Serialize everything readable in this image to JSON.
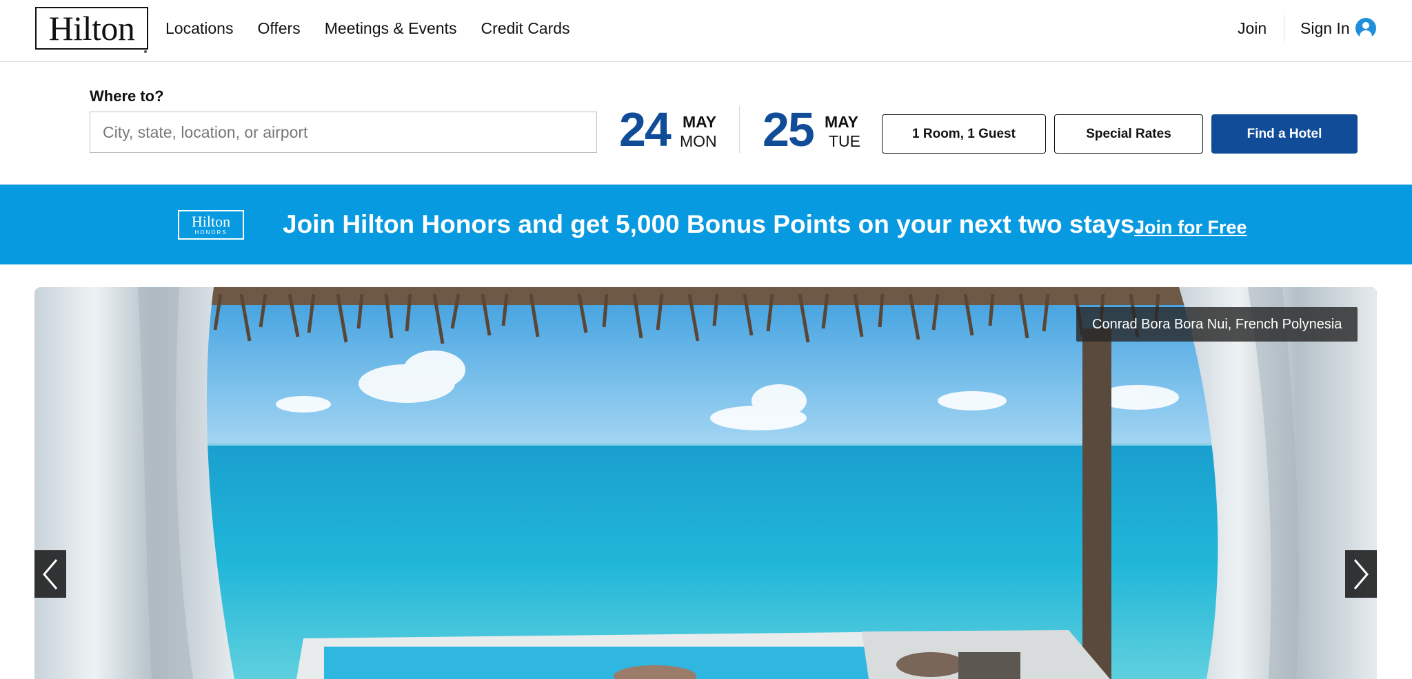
{
  "header": {
    "logo_text": "Hilton",
    "nav": [
      "Locations",
      "Offers",
      "Meetings & Events",
      "Credit Cards"
    ],
    "join": "Join",
    "sign_in": "Sign In",
    "user_icon": "user-circle-icon"
  },
  "search": {
    "where_label": "Where to?",
    "where_placeholder": "City, state, location, or airport",
    "check_in": {
      "day": "24",
      "month": "MAY",
      "weekday": "MON"
    },
    "check_out": {
      "day": "25",
      "month": "MAY",
      "weekday": "TUE"
    },
    "rooms_guests": "1 Room, 1 Guest",
    "special_rates": "Special Rates",
    "find_hotel": "Find a Hotel"
  },
  "banner": {
    "logo_text": "Hilton",
    "logo_subtext": "HONORS",
    "message": "Join Hilton Honors and get 5,000 Bonus Points on your next two stays.",
    "link": "Join for Free"
  },
  "hero": {
    "caption": "Conrad Bora Bora Nui, French Polynesia",
    "prev_icon": "chevron-left-icon",
    "next_icon": "chevron-right-icon"
  },
  "colors": {
    "brand_blue": "#104c97",
    "banner_blue": "#079ae0",
    "user_icon": "#1f8fdc"
  }
}
